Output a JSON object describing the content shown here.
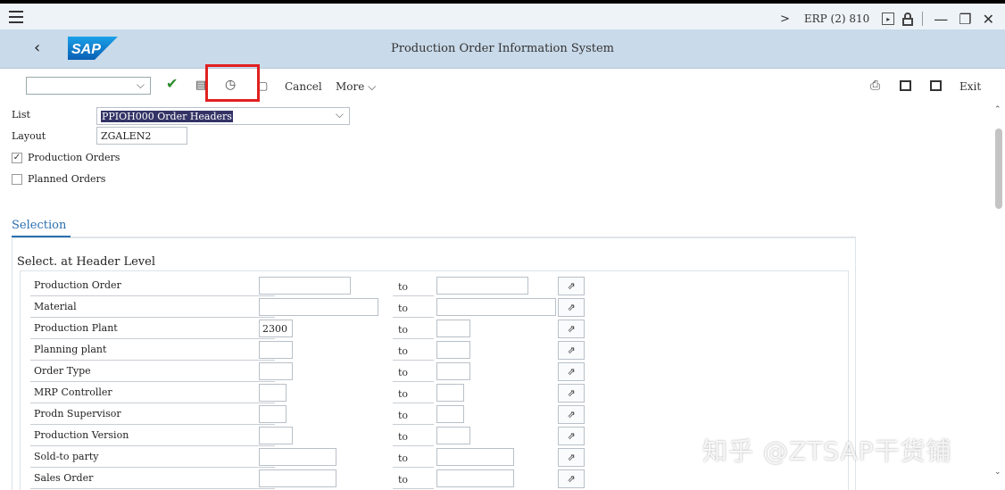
{
  "system": {
    "system_name": "ERP (2) 810",
    "chevron": ">",
    "play_glyph": "▸",
    "minimize_glyph": "—",
    "restore_glyph": "❐",
    "close_glyph": "✕"
  },
  "titlebar": {
    "back_glyph": "‹",
    "logo_text": "SAP",
    "title": "Production Order Information System"
  },
  "toolbar": {
    "command_dropdown_glyph": "⌵",
    "check_glyph": "✔",
    "save_glyph": "▤",
    "history_glyph": "◷",
    "new_session_glyph": "▢",
    "cancel_label": "Cancel",
    "more_label": "More ⌵",
    "print_glyph": "⎙",
    "exit_label": "Exit",
    "highlight_color": "#e02020"
  },
  "header_fields": {
    "list_label": "List",
    "list_value": "PPIOH000 Order Headers",
    "list_dropdown_glyph": "⌵",
    "layout_label": "Layout",
    "layout_value": "ZGALEN2",
    "production_orders_label": "Production Orders",
    "production_orders_checked": true,
    "production_orders_check_glyph": "✓",
    "planned_orders_label": "Planned Orders",
    "planned_orders_checked": false
  },
  "selection": {
    "tab_label": "Selection",
    "group_title": "Select. at Header Level",
    "to_label": "to",
    "multi_glyph": "⇗",
    "rows": [
      {
        "label": "Production Order",
        "from": ""
      },
      {
        "label": "Material",
        "from": ""
      },
      {
        "label": "Production Plant",
        "from": "2300"
      },
      {
        "label": "Planning plant",
        "from": ""
      },
      {
        "label": "Order Type",
        "from": ""
      },
      {
        "label": "MRP Controller",
        "from": ""
      },
      {
        "label": "Prodn Supervisor",
        "from": ""
      },
      {
        "label": "Production Version",
        "from": ""
      },
      {
        "label": "Sold-to party",
        "from": ""
      },
      {
        "label": "Sales Order",
        "from": ""
      }
    ]
  },
  "scrollbar": {
    "up_glyph": "⌃",
    "down_glyph": "⌄"
  },
  "watermark": "知乎 @ZTSAP干货铺"
}
